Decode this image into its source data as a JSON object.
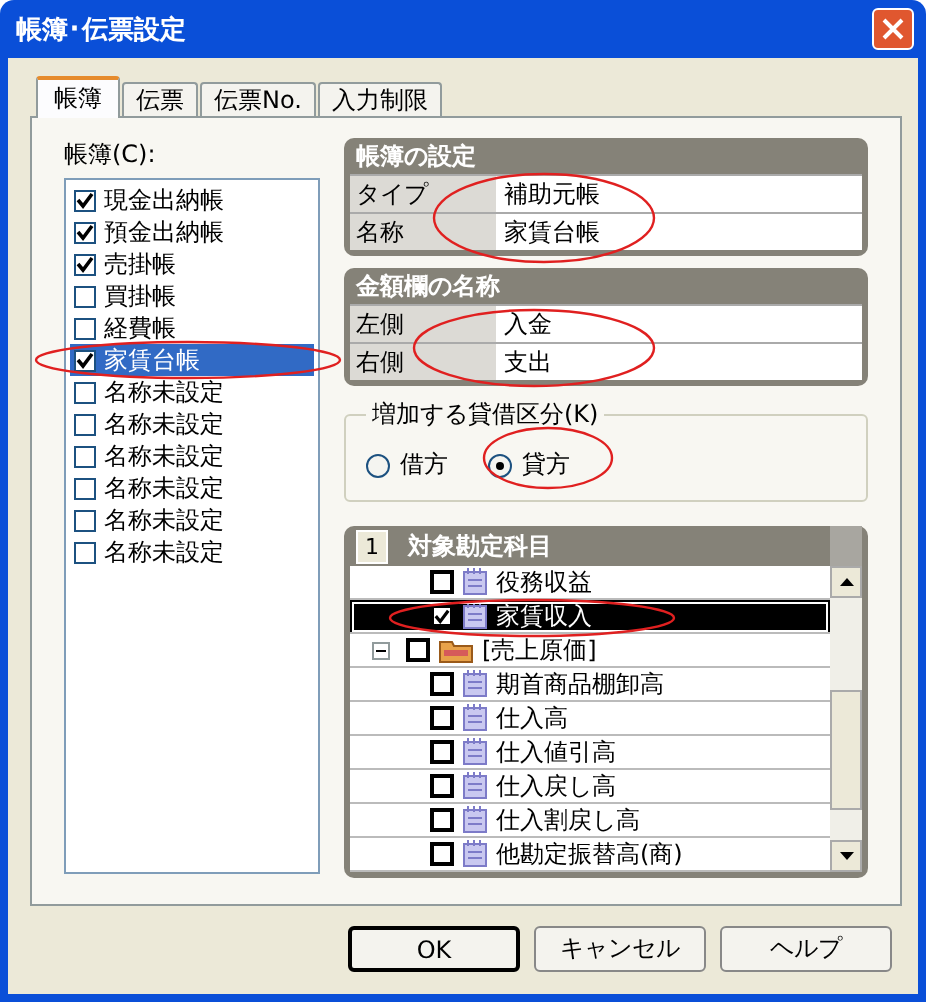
{
  "window": {
    "title": "帳簿･伝票設定"
  },
  "tabs": [
    {
      "label": "帳簿",
      "selected": true
    },
    {
      "label": "伝票",
      "selected": false
    },
    {
      "label": "伝票No.",
      "selected": false
    },
    {
      "label": "入力制限",
      "selected": false
    }
  ],
  "ledger_list": {
    "label": "帳簿(C):",
    "items": [
      {
        "label": "現金出納帳",
        "checked": true,
        "selected": false
      },
      {
        "label": "預金出納帳",
        "checked": true,
        "selected": false
      },
      {
        "label": "売掛帳",
        "checked": true,
        "selected": false
      },
      {
        "label": "買掛帳",
        "checked": false,
        "selected": false
      },
      {
        "label": "経費帳",
        "checked": false,
        "selected": false
      },
      {
        "label": "家賃台帳",
        "checked": true,
        "selected": true
      },
      {
        "label": "名称未設定",
        "checked": false,
        "selected": false
      },
      {
        "label": "名称未設定",
        "checked": false,
        "selected": false
      },
      {
        "label": "名称未設定",
        "checked": false,
        "selected": false
      },
      {
        "label": "名称未設定",
        "checked": false,
        "selected": false
      },
      {
        "label": "名称未設定",
        "checked": false,
        "selected": false
      },
      {
        "label": "名称未設定",
        "checked": false,
        "selected": false
      }
    ]
  },
  "ledger_settings": {
    "title": "帳簿の設定",
    "rows": [
      {
        "label": "タイプ",
        "value": "補助元帳"
      },
      {
        "label": "名称",
        "value": "家賃台帳"
      }
    ]
  },
  "amount_names": {
    "title": "金額欄の名称",
    "rows": [
      {
        "label": "左側",
        "value": "入金"
      },
      {
        "label": "右側",
        "value": "支出"
      }
    ]
  },
  "increase_side": {
    "label": "増加する貸借区分(K)",
    "options": [
      {
        "label": "借方",
        "selected": false
      },
      {
        "label": "貸方",
        "selected": true
      }
    ]
  },
  "accounts": {
    "number": "1",
    "title": "対象勘定科目",
    "items": [
      {
        "kind": "account",
        "label": "役務収益",
        "checked": false,
        "selected": false
      },
      {
        "kind": "account",
        "label": "家賃収入",
        "checked": true,
        "selected": true
      },
      {
        "kind": "folder",
        "label": "[売上原価]",
        "checked": false,
        "selected": false,
        "expanded": true,
        "children": [
          {
            "kind": "account",
            "label": "期首商品棚卸高",
            "checked": false,
            "selected": false
          },
          {
            "kind": "account",
            "label": "仕入高",
            "checked": false,
            "selected": false
          },
          {
            "kind": "account",
            "label": "仕入値引高",
            "checked": false,
            "selected": false
          },
          {
            "kind": "account",
            "label": "仕入戻し高",
            "checked": false,
            "selected": false
          },
          {
            "kind": "account",
            "label": "仕入割戻し高",
            "checked": false,
            "selected": false
          },
          {
            "kind": "account",
            "label": "他勘定振替高(商)",
            "checked": false,
            "selected": false
          }
        ]
      }
    ]
  },
  "buttons": [
    "OK",
    "キャンセル",
    "ヘルプ"
  ]
}
